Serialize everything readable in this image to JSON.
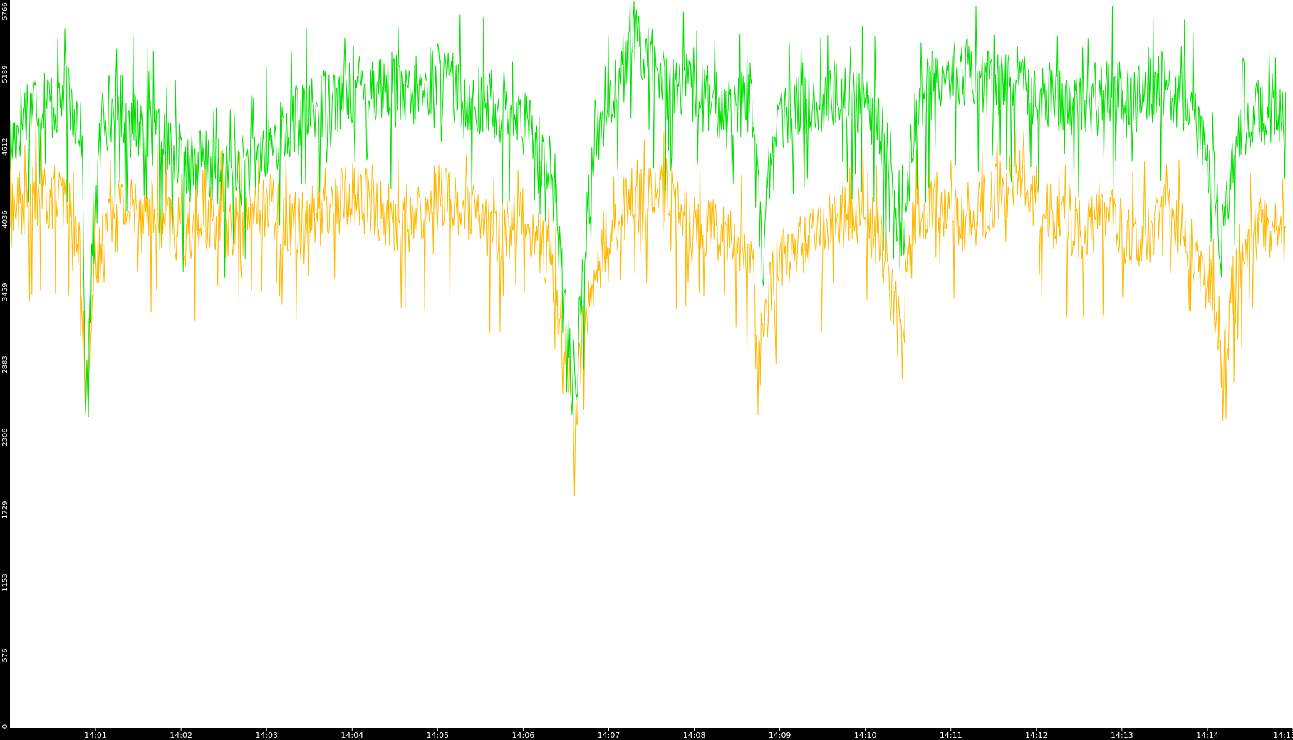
{
  "chart_data": {
    "type": "line",
    "title": "",
    "xlabel": "",
    "ylabel": "",
    "ylim": [
      0,
      5766
    ],
    "yticks": [
      "0",
      "576",
      "1153",
      "1729",
      "2306",
      "2883",
      "3459",
      "4036",
      "4612",
      "5189",
      "5766"
    ],
    "xticks": [
      "14:01",
      "14:02",
      "14:03",
      "14:04",
      "14:05",
      "14:06",
      "14:07",
      "14:08",
      "14:09",
      "14:10",
      "14:11",
      "14:12",
      "14:13",
      "14:14",
      "14:15"
    ],
    "xlim": [
      "14:00",
      "14:15"
    ],
    "grid": false,
    "legend": "none",
    "colors": {
      "background": "#ffffff",
      "axis": "#000000",
      "tick_text": "#ffffff"
    },
    "series": [
      {
        "color": "#00e000",
        "anchors": [
          [
            "14:00",
            4600
          ],
          [
            "14:00:10",
            4900
          ],
          [
            "14:00:20",
            5000
          ],
          [
            "14:00:30",
            4950
          ],
          [
            "14:00:40",
            5050
          ],
          [
            "14:00:50",
            4800
          ],
          [
            "14:00:53",
            2600
          ],
          [
            "14:00:55",
            2700
          ],
          [
            "14:00:57",
            3600
          ],
          [
            "14:01:05",
            4900
          ],
          [
            "14:01:20",
            4900
          ],
          [
            "14:01:40",
            4700
          ],
          [
            "14:02:00",
            4500
          ],
          [
            "14:02:20",
            4450
          ],
          [
            "14:02:40",
            4400
          ],
          [
            "14:03:00",
            4600
          ],
          [
            "14:03:20",
            4800
          ],
          [
            "14:03:40",
            4950
          ],
          [
            "14:04:00",
            5050
          ],
          [
            "14:04:20",
            5100
          ],
          [
            "14:04:40",
            4950
          ],
          [
            "14:05:00",
            5150
          ],
          [
            "14:05:20",
            5000
          ],
          [
            "14:05:40",
            4950
          ],
          [
            "14:06:00",
            4800
          ],
          [
            "14:06:20",
            4400
          ],
          [
            "14:06:30",
            3300
          ],
          [
            "14:06:36",
            2400
          ],
          [
            "14:06:40",
            3300
          ],
          [
            "14:06:50",
            4700
          ],
          [
            "14:07:00",
            5000
          ],
          [
            "14:07:20",
            5450
          ],
          [
            "14:07:40",
            5100
          ],
          [
            "14:08:00",
            5050
          ],
          [
            "14:08:20",
            4900
          ],
          [
            "14:08:40",
            4950
          ],
          [
            "14:08:48",
            3700
          ],
          [
            "14:08:55",
            4700
          ],
          [
            "14:09:10",
            4900
          ],
          [
            "14:09:30",
            5000
          ],
          [
            "14:09:50",
            5050
          ],
          [
            "14:10:10",
            4800
          ],
          [
            "14:10:25",
            3800
          ],
          [
            "14:10:35",
            4900
          ],
          [
            "14:10:50",
            5150
          ],
          [
            "14:11:10",
            5200
          ],
          [
            "14:11:30",
            5100
          ],
          [
            "14:11:50",
            5150
          ],
          [
            "14:12:10",
            5000
          ],
          [
            "14:12:30",
            4950
          ],
          [
            "14:12:50",
            5050
          ],
          [
            "14:13:10",
            5000
          ],
          [
            "14:13:30",
            5100
          ],
          [
            "14:13:50",
            4900
          ],
          [
            "14:14:05",
            4300
          ],
          [
            "14:14:10",
            3800
          ],
          [
            "14:14:20",
            4700
          ],
          [
            "14:14:40",
            4900
          ],
          [
            "14:14:55",
            4800
          ]
        ],
        "amplitude": 320
      },
      {
        "color": "#ffb800",
        "anchors": [
          [
            "14:00",
            4100
          ],
          [
            "14:00:20",
            4250
          ],
          [
            "14:00:40",
            4150
          ],
          [
            "14:00:50",
            3700
          ],
          [
            "14:00:53",
            2600
          ],
          [
            "14:00:57",
            3400
          ],
          [
            "14:01:10",
            4150
          ],
          [
            "14:01:40",
            4100
          ],
          [
            "14:02:00",
            3900
          ],
          [
            "14:02:20",
            4050
          ],
          [
            "14:02:40",
            3950
          ],
          [
            "14:03:00",
            4150
          ],
          [
            "14:03:20",
            4000
          ],
          [
            "14:03:40",
            4100
          ],
          [
            "14:04:00",
            4250
          ],
          [
            "14:04:20",
            4100
          ],
          [
            "14:04:40",
            3950
          ],
          [
            "14:05:00",
            4250
          ],
          [
            "14:05:20",
            4100
          ],
          [
            "14:05:40",
            3900
          ],
          [
            "14:06:00",
            4050
          ],
          [
            "14:06:20",
            3700
          ],
          [
            "14:06:30",
            3000
          ],
          [
            "14:06:36",
            2450
          ],
          [
            "14:06:45",
            3300
          ],
          [
            "14:07:00",
            3950
          ],
          [
            "14:07:20",
            4250
          ],
          [
            "14:07:40",
            4200
          ],
          [
            "14:08:00",
            4000
          ],
          [
            "14:08:20",
            4000
          ],
          [
            "14:08:40",
            3700
          ],
          [
            "14:08:48",
            3000
          ],
          [
            "14:08:55",
            3600
          ],
          [
            "14:09:10",
            3800
          ],
          [
            "14:09:30",
            3950
          ],
          [
            "14:09:50",
            4100
          ],
          [
            "14:10:10",
            3900
          ],
          [
            "14:10:25",
            3200
          ],
          [
            "14:10:35",
            4100
          ],
          [
            "14:10:50",
            4150
          ],
          [
            "14:11:10",
            4000
          ],
          [
            "14:11:30",
            4200
          ],
          [
            "14:11:50",
            4350
          ],
          [
            "14:12:10",
            4050
          ],
          [
            "14:12:30",
            3950
          ],
          [
            "14:12:50",
            4050
          ],
          [
            "14:13:10",
            3800
          ],
          [
            "14:13:30",
            4100
          ],
          [
            "14:13:50",
            3800
          ],
          [
            "14:14:05",
            3400
          ],
          [
            "14:14:10",
            2700
          ],
          [
            "14:14:20",
            3700
          ],
          [
            "14:14:40",
            4000
          ],
          [
            "14:14:55",
            3900
          ]
        ],
        "amplitude": 300
      }
    ]
  }
}
